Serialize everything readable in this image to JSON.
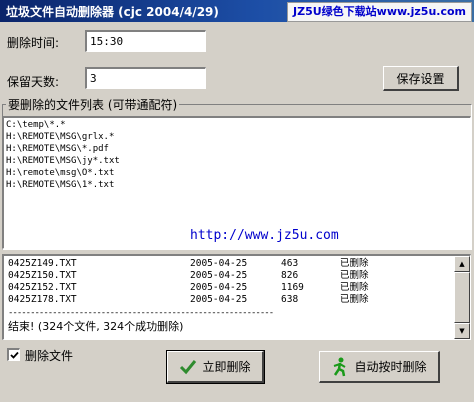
{
  "window": {
    "title": "垃圾文件自动删除器 (cjc 2004/4/29)",
    "watermark": "JZ5U绿色下载站www.jz5u.com"
  },
  "form": {
    "delete_time_label": "删除时间:",
    "delete_time_value": "15:30",
    "keep_days_label": "保留天数:",
    "keep_days_value": "3",
    "save_button": "保存设置"
  },
  "file_list": {
    "title": "要删除的文件列表 (可带通配符)",
    "items": [
      "C:\\temp\\*.*",
      "H:\\REMOTE\\MSG\\grlx.*",
      "H:\\REMOTE\\MSG\\*.pdf",
      "H:\\REMOTE\\MSG\\jy*.txt",
      "H:\\remote\\msg\\O*.txt",
      "H:\\REMOTE\\MSG\\1*.txt"
    ],
    "url_text": "http://www.jz5u.com"
  },
  "log": {
    "rows": [
      {
        "file": "0425Z149.TXT",
        "date": "2005-04-25",
        "size": "463",
        "status": "已删除"
      },
      {
        "file": "0425Z150.TXT",
        "date": "2005-04-25",
        "size": "826",
        "status": "已删除"
      },
      {
        "file": "0425Z152.TXT",
        "date": "2005-04-25",
        "size": "1169",
        "status": "已删除"
      },
      {
        "file": "0425Z178.TXT",
        "date": "2005-04-25",
        "size": "638",
        "status": "已删除"
      }
    ],
    "separator": "------------------------------------------------------------",
    "summary": "结束! (324个文件, 324个成功删除)"
  },
  "bottom": {
    "delete_files_checkbox": "删除文件",
    "delete_now_button": "立即删除",
    "auto_delete_button": "自动按时删除"
  },
  "colors": {
    "titlebar": "#0a246a",
    "face": "#d4d0c8",
    "link": "#0000cc",
    "check": "#2e8b2e",
    "runner": "#1a9a1a"
  }
}
